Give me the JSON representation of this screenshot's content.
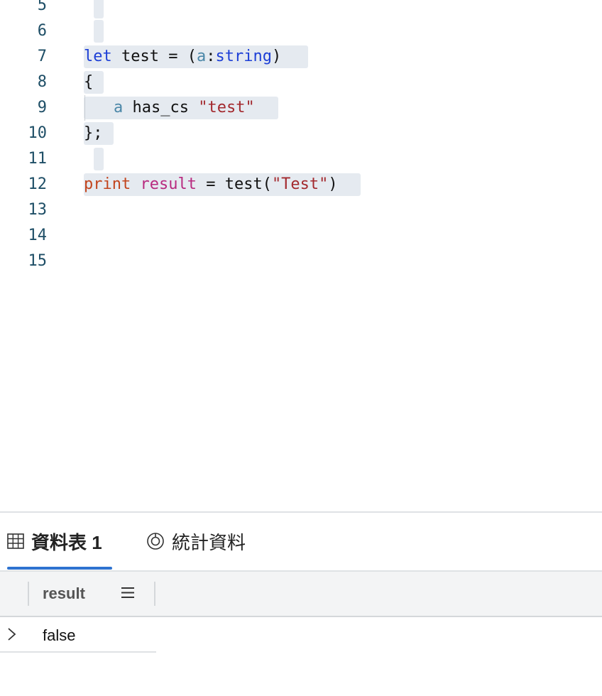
{
  "editor": {
    "line_numbers": [
      "5",
      "6",
      "7",
      "8",
      "9",
      "10",
      "11",
      "12",
      "13",
      "14",
      "15"
    ],
    "line7": {
      "kw": "let",
      "name": " test = (",
      "param": "a",
      "colon": ":",
      "type": "string",
      "close": ")"
    },
    "line8": {
      "text": "{"
    },
    "line9": {
      "param": "a",
      "op": " has_cs ",
      "str": "\"test\""
    },
    "line10": {
      "text": "};"
    },
    "line12": {
      "print": "print",
      "var": "result",
      "mid": " = test(",
      "str": "\"Test\"",
      "close": ")"
    }
  },
  "results": {
    "tabs": [
      {
        "label": "資料表 1",
        "icon": "table-icon",
        "active": true
      },
      {
        "label": "統計資料",
        "icon": "stats-icon",
        "active": false
      }
    ],
    "columns": [
      "result"
    ],
    "rows": [
      [
        "false"
      ]
    ]
  },
  "colors": {
    "keyword": "#1d3fd6",
    "string": "#a3292e",
    "function": "#c2451e",
    "variable": "#b82a7f",
    "parameter": "#4b87a8",
    "tab_accent": "#2e73d0",
    "selection": "#e5eaf0"
  }
}
